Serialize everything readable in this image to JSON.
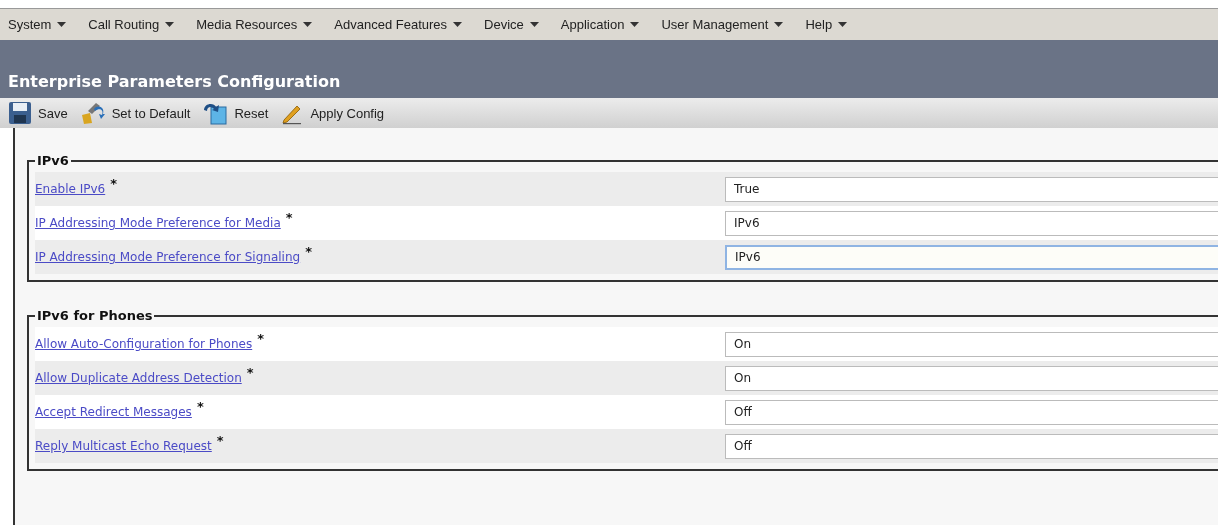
{
  "menu": [
    {
      "label": "System"
    },
    {
      "label": "Call Routing"
    },
    {
      "label": "Media Resources"
    },
    {
      "label": "Advanced Features"
    },
    {
      "label": "Device"
    },
    {
      "label": "Application"
    },
    {
      "label": "User Management"
    },
    {
      "label": "Help"
    }
  ],
  "page_title": "Enterprise Parameters Configuration",
  "toolbar": [
    {
      "kind": "save",
      "label": "Save"
    },
    {
      "kind": "default",
      "label": "Set to Default"
    },
    {
      "kind": "reset",
      "label": "Reset"
    },
    {
      "kind": "apply",
      "label": "Apply Config"
    }
  ],
  "sections": [
    {
      "title": "IPv6",
      "params": [
        {
          "label": "Enable IPv6",
          "required": "*",
          "value": "True",
          "focused": false
        },
        {
          "label": "IP Addressing Mode Preference for Media",
          "required": "*",
          "value": "IPv6",
          "focused": false
        },
        {
          "label": "IP Addressing Mode Preference for Signaling",
          "required": "*",
          "value": "IPv6",
          "focused": true
        }
      ]
    },
    {
      "title": "IPv6 for Phones",
      "params": [
        {
          "label": "Allow Auto-Configuration for Phones",
          "required": "*",
          "value": "On",
          "focused": false
        },
        {
          "label": "Allow Duplicate Address Detection",
          "required": "*",
          "value": "On",
          "focused": false
        },
        {
          "label": "Accept Redirect Messages",
          "required": "*",
          "value": "Off",
          "focused": false
        },
        {
          "label": "Reply Multicast Echo Request",
          "required": "*",
          "value": "Off",
          "focused": false
        }
      ]
    }
  ]
}
